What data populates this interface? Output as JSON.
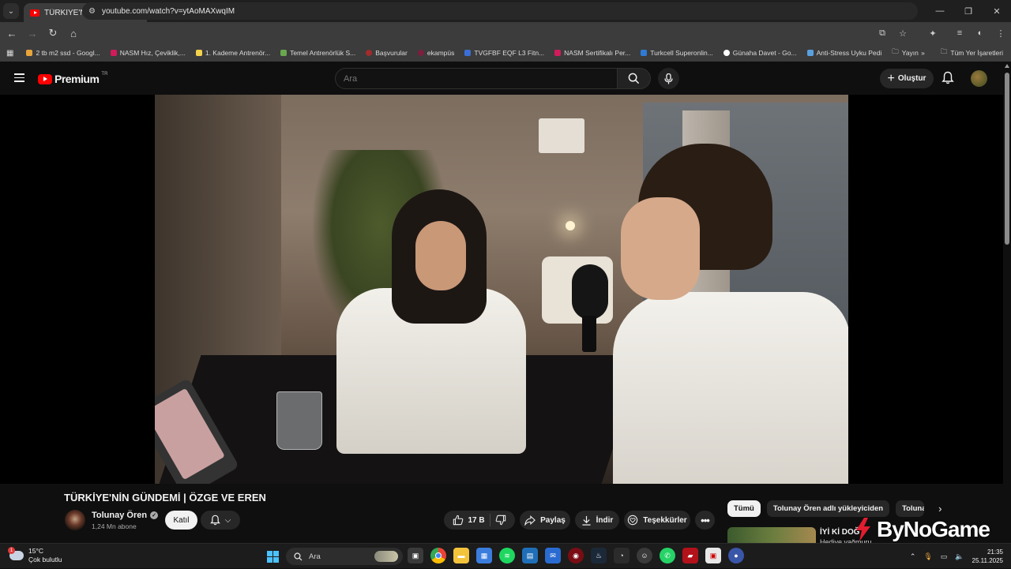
{
  "browser": {
    "tab_title": "TÜRKİYE'NİN GÜNDEMİ | ÖZGE",
    "url": "youtube.com/watch?v=ytAoMAXwqIM",
    "bookmarks": [
      {
        "label": "2 tb m2 ssd - Googl...",
        "color": "#e9a53a"
      },
      {
        "label": "NASM Hız, Çeviklik,...",
        "color": "#d11b5b"
      },
      {
        "label": "1. Kademe Antrenör...",
        "color": "#f5d24b"
      },
      {
        "label": "Temel Antrenörlük S...",
        "color": "#6aa84f"
      },
      {
        "label": "Başvurular",
        "color": "#a12c2c"
      },
      {
        "label": "ekampüs",
        "color": "#7a1f3d"
      },
      {
        "label": "TVGFBF EQF L3 Fitn...",
        "color": "#3b6fd6"
      },
      {
        "label": "NASM Sertifikalı Per...",
        "color": "#d11b5b"
      },
      {
        "label": "Turkcell Superonlin...",
        "color": "#2f7bd6"
      },
      {
        "label": "Günaha Davet - Go...",
        "color": "#ffffff"
      },
      {
        "label": "Anti-Stress Uyku Pedi",
        "color": "#5aa0e0"
      },
      {
        "label": "Yayın",
        "color": "#cfcfcf"
      }
    ],
    "all_bookmarks_label": "Tüm Yer İşaretleri"
  },
  "youtube": {
    "logo_text": "Premium",
    "country_code": "TR",
    "search_placeholder": "Ara",
    "create_label": "Oluştur"
  },
  "video": {
    "title": "TÜRKİYE'NİN GÜNDEMİ | ÖZGE VE EREN",
    "channel_name": "Tolunay Ören",
    "subscribers": "1,24 Mn abone",
    "join_label": "Katıl",
    "likes": "17 B",
    "share_label": "Paylaş",
    "download_label": "İndir",
    "thanks_label": "Teşekkürler"
  },
  "sidebar": {
    "chips": [
      "Tümü",
      "Tolunay Ören adlı yükleyiciden",
      "Tolunay"
    ],
    "rec_title": "İYİ Kİ DOĞ",
    "rec_sub": "Hediye yağmuru"
  },
  "watermark_text": "ByNoGame",
  "taskbar": {
    "temperature": "15°C",
    "weather_desc": "Çok bulutlu",
    "search_label": "Ara",
    "time": "21:35",
    "date": "25.11.2025"
  }
}
